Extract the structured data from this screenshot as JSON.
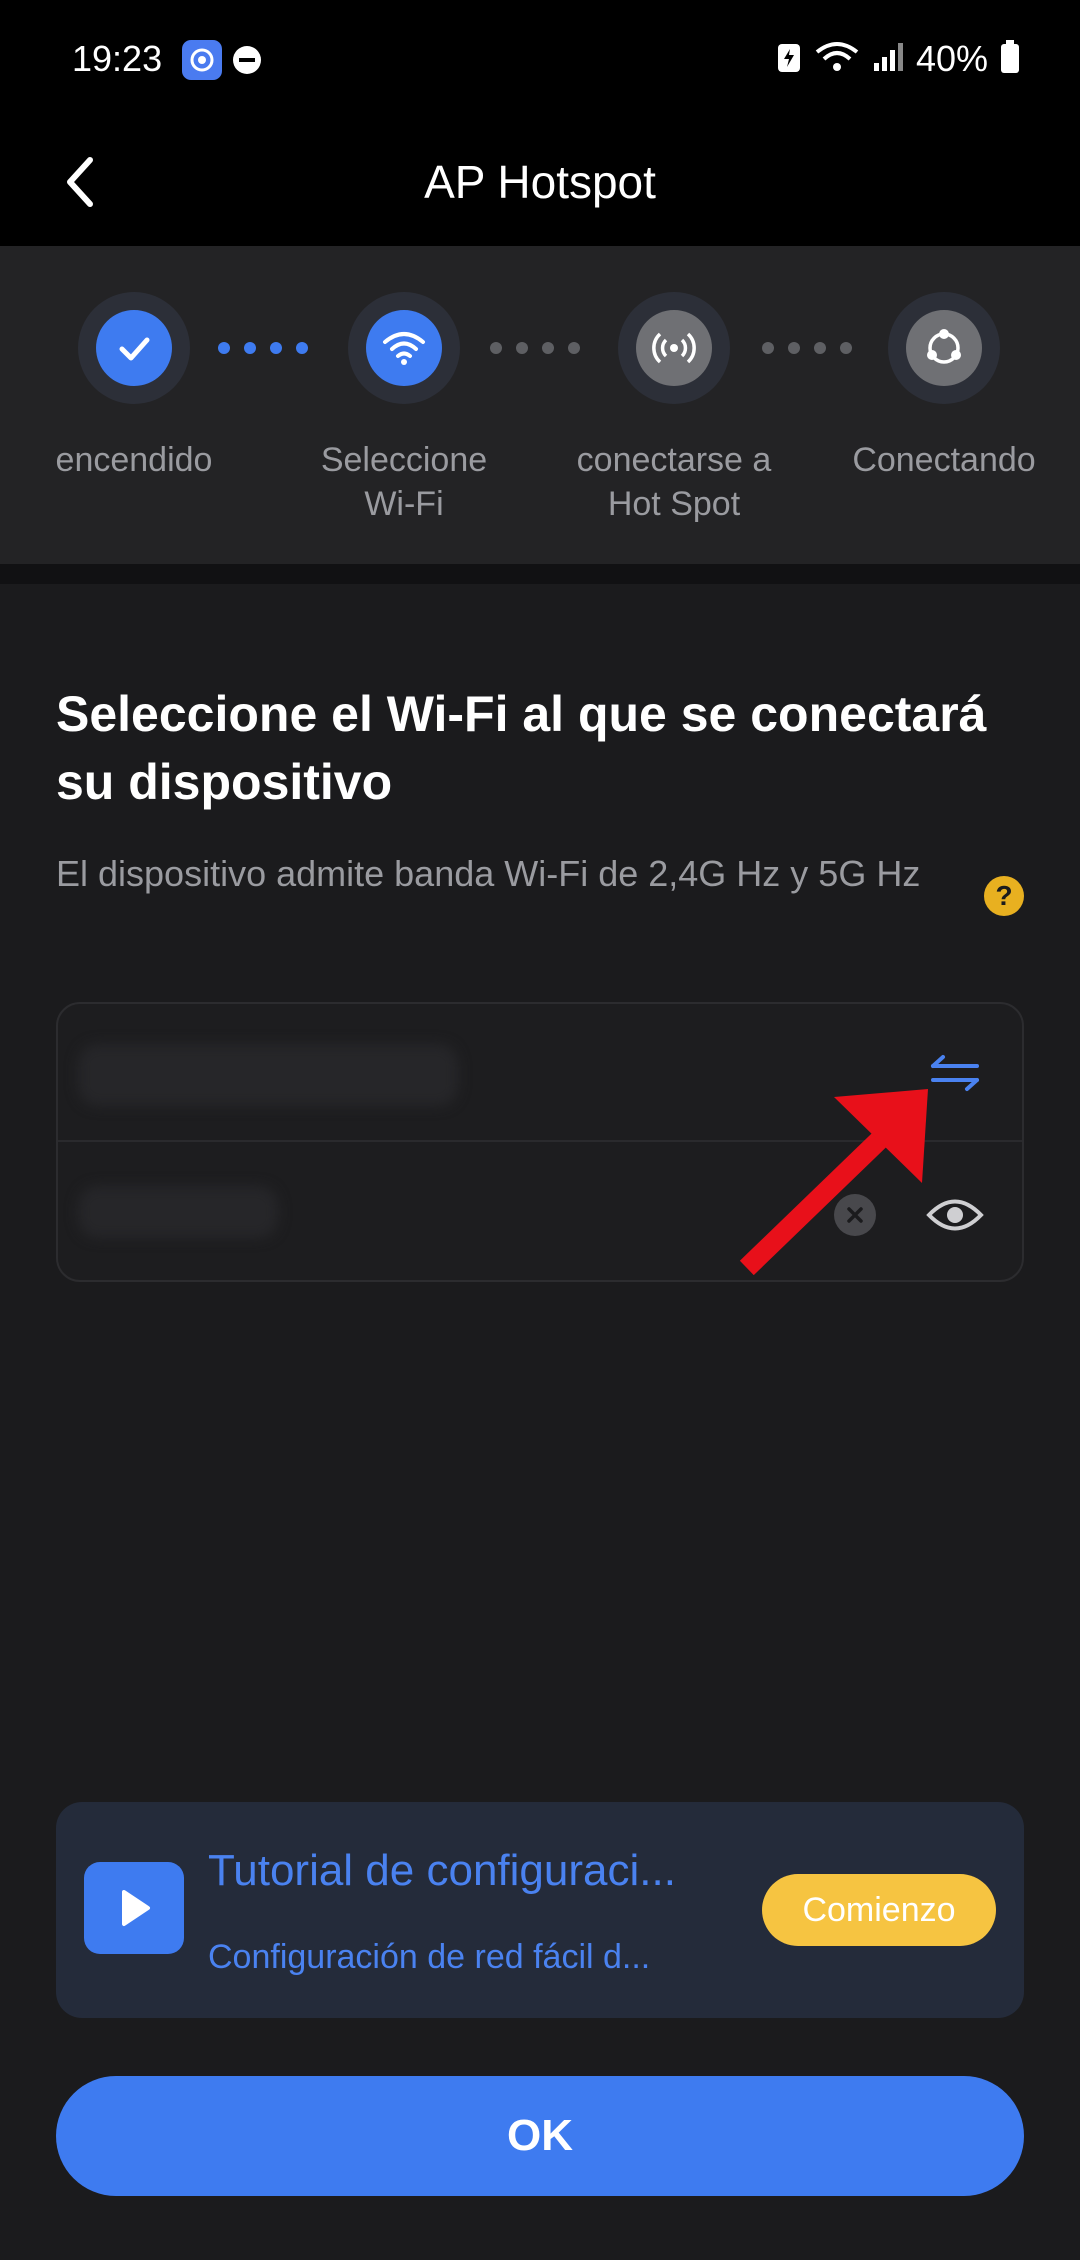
{
  "status_bar": {
    "time": "19:23",
    "battery": "40%"
  },
  "header": {
    "title": "AP Hotspot",
    "back_icon": "chevron-left-icon"
  },
  "stepper": {
    "steps": [
      {
        "label": "encendido",
        "icon": "check-icon",
        "state": "done"
      },
      {
        "label": "Seleccione Wi-Fi",
        "icon": "wifi-icon",
        "state": "active"
      },
      {
        "label": "conectarse a Hot Spot",
        "icon": "hotspot-icon",
        "state": "pending"
      },
      {
        "label": "Conectando",
        "icon": "connecting-icon",
        "state": "pending"
      }
    ]
  },
  "main": {
    "heading": "Seleccione el Wi-Fi al que se conectará su dispositivo",
    "subtext": "El dispositivo admite banda Wi-Fi de 2,4G Hz y 5G Hz"
  },
  "wifi_form": {
    "ssid_value": "",
    "password_value": ""
  },
  "tutorial": {
    "title": "Tutorial de configuraci...",
    "subtitle": "Configuración de red fácil d...",
    "start_label": "Comienzo"
  },
  "footer": {
    "ok_label": "OK"
  },
  "colors": {
    "accent": "#3e7bf0",
    "warning": "#f6c441",
    "annotation": "#e8101a"
  }
}
